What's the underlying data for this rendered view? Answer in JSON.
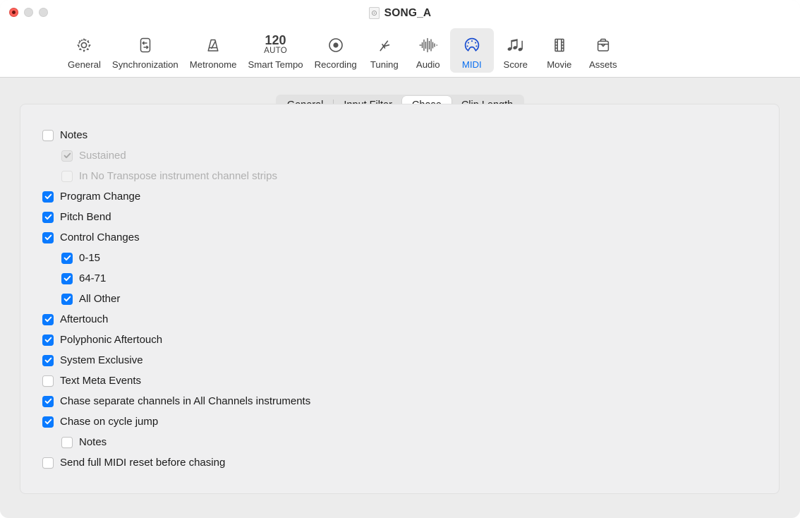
{
  "window": {
    "title": "SONG_A",
    "accent_color": "#0a7aff",
    "selected_tab_label_color": "#0a6ff0",
    "traffic_lights": {
      "close": "close-button",
      "minimize": "minimize-button",
      "maximize": "maximize-button"
    }
  },
  "toolbar": {
    "items": [
      {
        "label": "General",
        "icon": "gear-icon",
        "selected": false
      },
      {
        "label": "Synchronization",
        "icon": "sync-arrows-icon",
        "selected": false
      },
      {
        "label": "Metronome",
        "icon": "metronome-icon",
        "selected": false
      },
      {
        "label": "Smart Tempo",
        "icon": "tempo-120-auto-icon",
        "selected": false,
        "tempo_value": "120",
        "tempo_mode": "AUTO"
      },
      {
        "label": "Recording",
        "icon": "record-circle-icon",
        "selected": false
      },
      {
        "label": "Tuning",
        "icon": "tuning-fork-icon",
        "selected": false
      },
      {
        "label": "Audio",
        "icon": "waveform-icon",
        "selected": false
      },
      {
        "label": "MIDI",
        "icon": "midi-connector-icon",
        "selected": true
      },
      {
        "label": "Score",
        "icon": "music-notes-icon",
        "selected": false
      },
      {
        "label": "Movie",
        "icon": "film-strip-icon",
        "selected": false
      },
      {
        "label": "Assets",
        "icon": "briefcase-icon",
        "selected": false
      }
    ]
  },
  "segmented_control": {
    "segments": [
      {
        "label": "General",
        "selected": false
      },
      {
        "label": "Input Filter",
        "selected": false
      },
      {
        "label": "Chase",
        "selected": true
      },
      {
        "label": "Clip Length",
        "selected": false
      }
    ]
  },
  "chase_options": [
    {
      "label": "Notes",
      "state": "off",
      "indent": 0,
      "enabled": true
    },
    {
      "label": "Sustained",
      "state": "disabled-on",
      "indent": 1,
      "enabled": false
    },
    {
      "label": "In No Transpose instrument channel strips",
      "state": "disabled-off",
      "indent": 1,
      "enabled": false
    },
    {
      "label": "Program Change",
      "state": "on",
      "indent": 0,
      "enabled": true
    },
    {
      "label": "Pitch Bend",
      "state": "on",
      "indent": 0,
      "enabled": true
    },
    {
      "label": "Control Changes",
      "state": "on",
      "indent": 0,
      "enabled": true
    },
    {
      "label": "0-15",
      "state": "on",
      "indent": 1,
      "enabled": true
    },
    {
      "label": "64-71",
      "state": "on",
      "indent": 1,
      "enabled": true
    },
    {
      "label": "All Other",
      "state": "on",
      "indent": 1,
      "enabled": true
    },
    {
      "label": "Aftertouch",
      "state": "on",
      "indent": 0,
      "enabled": true
    },
    {
      "label": "Polyphonic Aftertouch",
      "state": "on",
      "indent": 0,
      "enabled": true
    },
    {
      "label": "System Exclusive",
      "state": "on",
      "indent": 0,
      "enabled": true
    },
    {
      "label": "Text Meta Events",
      "state": "off",
      "indent": 0,
      "enabled": true
    },
    {
      "label": "Chase separate channels in All Channels instruments",
      "state": "on",
      "indent": 0,
      "enabled": true
    },
    {
      "label": "Chase on cycle jump",
      "state": "on",
      "indent": 0,
      "enabled": true
    },
    {
      "label": "Notes",
      "state": "off",
      "indent": 1,
      "enabled": true
    },
    {
      "label": "Send full MIDI reset before chasing",
      "state": "off",
      "indent": 0,
      "enabled": true
    }
  ]
}
